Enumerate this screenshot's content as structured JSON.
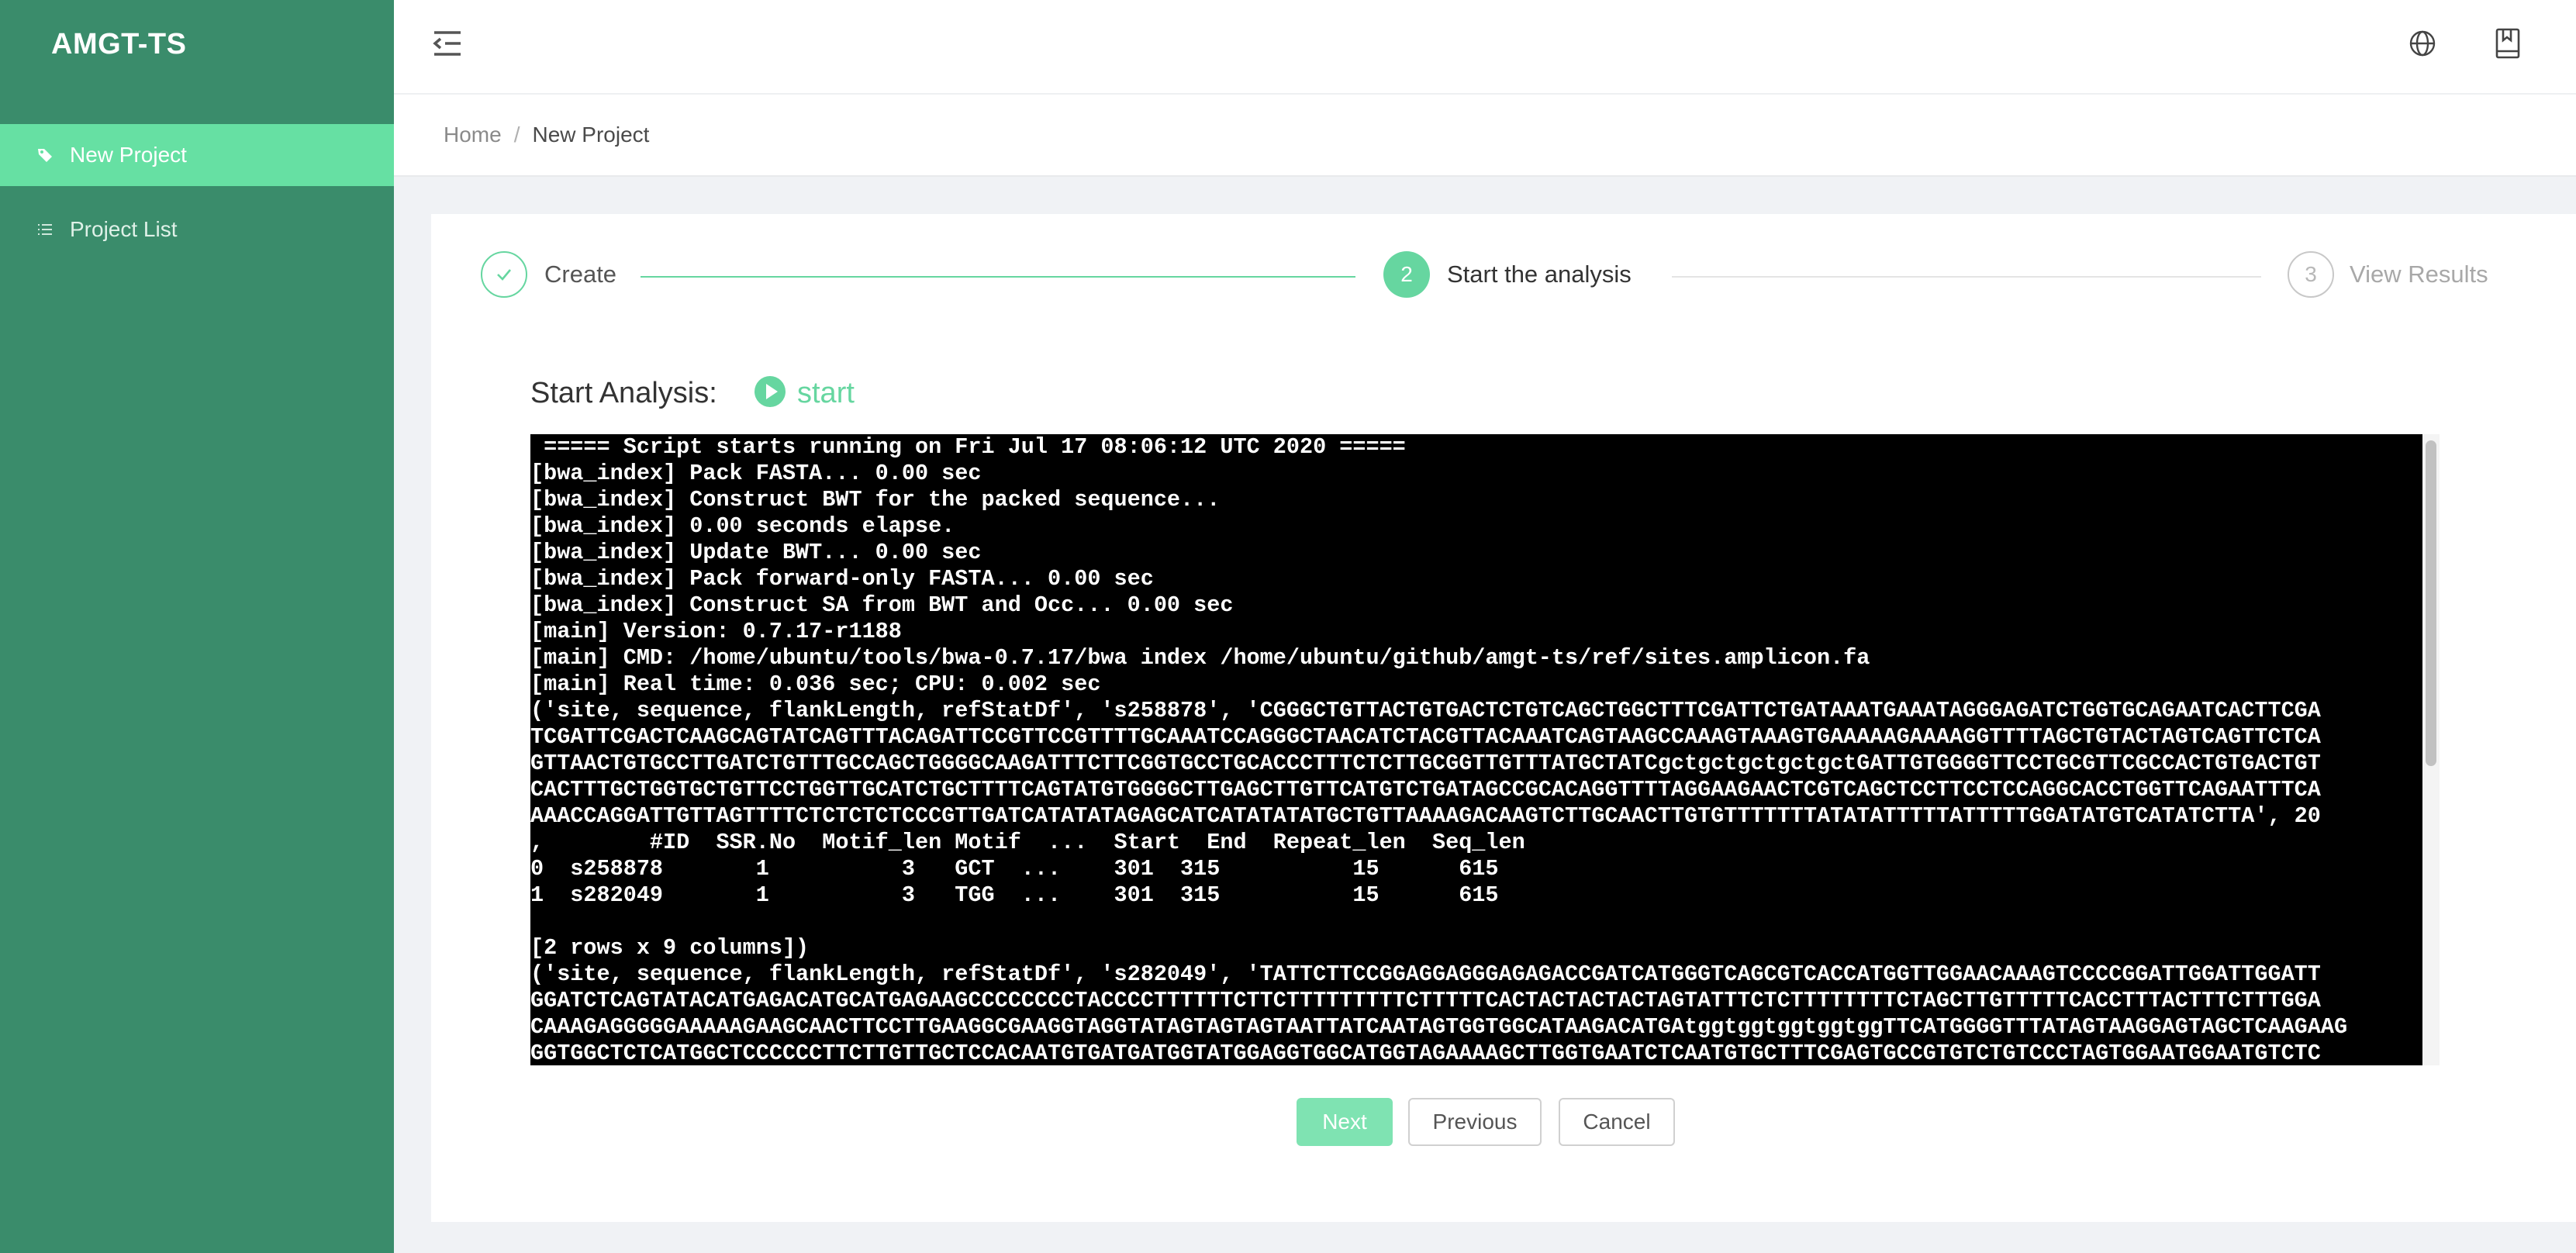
{
  "app": {
    "title": "AMGT-TS"
  },
  "sidebar": {
    "items": [
      {
        "label": "New Project",
        "icon": "tag-icon",
        "active": true
      },
      {
        "label": "Project List",
        "icon": "list-icon",
        "active": false
      }
    ]
  },
  "header": {
    "icons": [
      "menu-collapse-icon",
      "globe-icon",
      "book-icon"
    ]
  },
  "breadcrumb": {
    "home": "Home",
    "separator": "/",
    "current": "New Project"
  },
  "steps": [
    {
      "number": "1",
      "label": "Create",
      "status": "done"
    },
    {
      "number": "2",
      "label": "Start the analysis",
      "status": "active"
    },
    {
      "number": "3",
      "label": "View Results",
      "status": "pending"
    }
  ],
  "analysis": {
    "title": "Start Analysis:",
    "start_label": "start",
    "log_lines": [
      " ===== Script starts running on Fri Jul 17 08:06:12 UTC 2020 =====",
      "[bwa_index] Pack FASTA... 0.00 sec",
      "[bwa_index] Construct BWT for the packed sequence...",
      "[bwa_index] 0.00 seconds elapse.",
      "[bwa_index] Update BWT... 0.00 sec",
      "[bwa_index] Pack forward-only FASTA... 0.00 sec",
      "[bwa_index] Construct SA from BWT and Occ... 0.00 sec",
      "[main] Version: 0.7.17-r1188",
      "[main] CMD: /home/ubuntu/tools/bwa-0.7.17/bwa index /home/ubuntu/github/amgt-ts/ref/sites.amplicon.fa",
      "[main] Real time: 0.036 sec; CPU: 0.002 sec",
      "('site, sequence, flankLength, refStatDf', 's258878', 'CGGGCTGTTACTGTGACTCTGTCAGCTGGCTTTCGATTCTGATAAATGAAATAGGGAGATCTGGTGCAGAATCACTTCGA",
      "TCGATTCGACTCAAGCAGTATCAGTTTACAGATTCCGTTCCGTTTTGCAAATCCAGGGCTAACATCTACGTTACAAATCAGTAAGCCAAAGTAAAGTGAAAAAGAAAAGGTTTTAGCTGTACTAGTCAGTTCTCA",
      "GTTAACTGTGCCTTGATCTGTTTGCCAGCTGGGGCAAGATTTCTTCGGTGCCTGCACCCTTTCTCTTGCGGTTGTTTATGCTATCgctgctgctgctgctGATTGTGGGGTTCCTGCGTTCGCCACTGTGACTGT",
      "CACTTTGCTGGTGCTGTTCCTGGTTGCATCTGCTTTTCAGTATGTGGGGCTTGAGCTTGTTCATGTCTGATAGCCGCACAGGTTTTAGGAAGAACTCGTCAGCTCCTTCCTCCAGGCACCTGGTTCAGAATTTCA",
      "AAACCAGGATTGTTAGTTTTCTCTCTCTCCCGTTGATCATATATAGAGCATCATATATATGCTGTTAAAAGACAAGTCTTGCAACTTGTGTTTTTTTATATATTTTTATTTTTGGATATGTCATATCTTA', 20",
      ",        #ID  SSR.No  Motif_len Motif  ...  Start  End  Repeat_len  Seq_len",
      "0  s258878       1          3   GCT  ...    301  315          15      615",
      "1  s282049       1          3   TGG  ...    301  315          15      615",
      "",
      "[2 rows x 9 columns])",
      "('site, sequence, flankLength, refStatDf', 's282049', 'TATTCTTCCGGAGGAGGGAGAGACCGATCATGGGTCAGCGTCACCATGGTTGGAACAAAGTCCCCGGATTGGATTGGATT",
      "GGATCTCAGTATACATGAGACATGCATGAGAAGCCCCCCCCTACCCCTTTTTTCTTCTTTTTTTTTCTTTTTCACTACTACTACTAGTATTTCTCTTTTTTTTCTAGCTTGTTTTTCACCTTTACTTTCTTTGGA",
      "CAAAGAGGGGGAAAAAGAAGCAACTTCCTTGAAGGCGAAGGTAGGTATAGTAGTAGTAATTATCAATAGTGGTGGCATAAGACATGAtggtggtggtggtggTTCATGGGGTTTATAGTAAGGAGTAGCTCAAGAAG",
      "GGTGGCTCTCATGGCTCCCCCCTTCTTGTTGCTCCACAATGTGATGATGGTATGGAGGTGGCATGGTAGAAAAGCTTGGTGAATCTCAATGTGCTTTCGAGTGCCGTGTCTGTCCCTAGTGGAATGGAATGTCTC"
    ]
  },
  "buttons": {
    "next": "Next",
    "previous": "Previous",
    "cancel": "Cancel"
  },
  "colors": {
    "sidebar_bg": "#3a8c6b",
    "sidebar_active": "#66e0a3",
    "accent": "#66d6a0",
    "terminal_bg": "#000000"
  }
}
